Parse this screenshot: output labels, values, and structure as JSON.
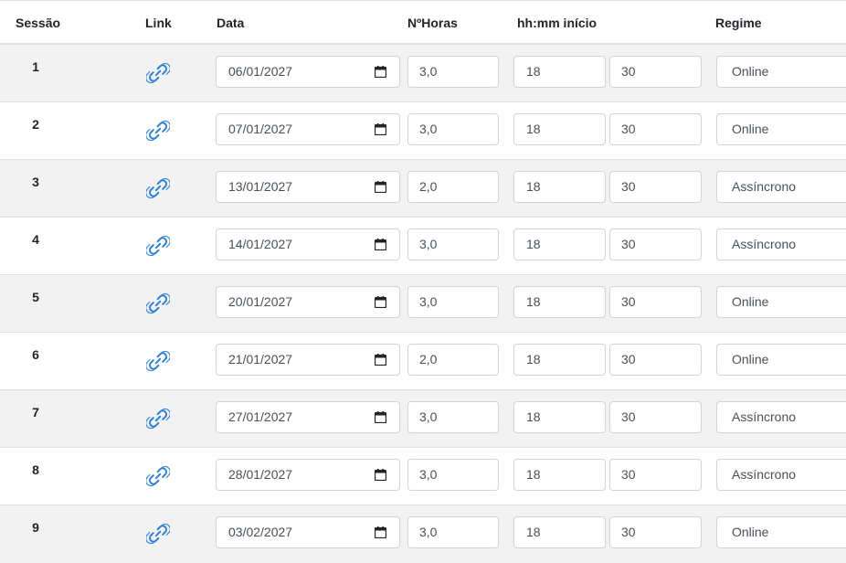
{
  "headers": {
    "sessao": "Sessão",
    "link": "Link",
    "data": "Data",
    "horas": "NºHoras",
    "inicio": "hh:mm início",
    "regime": "Regime"
  },
  "icons": {
    "link": "link-icon",
    "calendar": "calendar-icon"
  },
  "colors": {
    "link_icon": "#2d7fd3",
    "stripe": "#f2f2f2"
  },
  "rows": [
    {
      "sessao": "1",
      "data": "06/01/2027",
      "horas": "3,0",
      "hh": "18",
      "mm": "30",
      "regime": "Online"
    },
    {
      "sessao": "2",
      "data": "07/01/2027",
      "horas": "3,0",
      "hh": "18",
      "mm": "30",
      "regime": "Online"
    },
    {
      "sessao": "3",
      "data": "13/01/2027",
      "horas": "2,0",
      "hh": "18",
      "mm": "30",
      "regime": "Assíncrono"
    },
    {
      "sessao": "4",
      "data": "14/01/2027",
      "horas": "3,0",
      "hh": "18",
      "mm": "30",
      "regime": "Assíncrono"
    },
    {
      "sessao": "5",
      "data": "20/01/2027",
      "horas": "3,0",
      "hh": "18",
      "mm": "30",
      "regime": "Online"
    },
    {
      "sessao": "6",
      "data": "21/01/2027",
      "horas": "2,0",
      "hh": "18",
      "mm": "30",
      "regime": "Online"
    },
    {
      "sessao": "7",
      "data": "27/01/2027",
      "horas": "3,0",
      "hh": "18",
      "mm": "30",
      "regime": "Assíncrono"
    },
    {
      "sessao": "8",
      "data": "28/01/2027",
      "horas": "3,0",
      "hh": "18",
      "mm": "30",
      "regime": "Assíncrono"
    },
    {
      "sessao": "9",
      "data": "03/02/2027",
      "horas": "3,0",
      "hh": "18",
      "mm": "30",
      "regime": "Online"
    }
  ]
}
